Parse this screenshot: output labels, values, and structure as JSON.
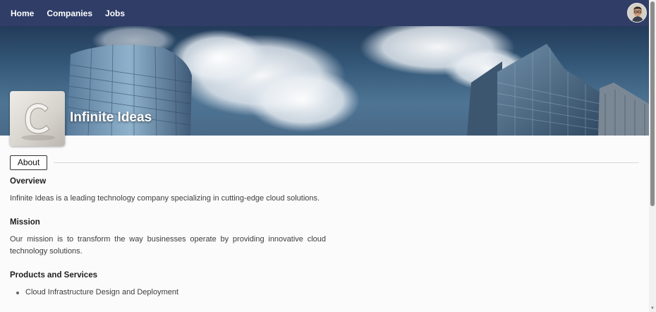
{
  "nav": {
    "links": [
      "Home",
      "Companies",
      "Jobs"
    ]
  },
  "company": {
    "name": "Infinite Ideas",
    "logo_letter": "C"
  },
  "tabs": {
    "about_label": "About"
  },
  "sections": {
    "overview": {
      "title": "Overview",
      "text": "Infinite Ideas is a leading technology company specializing in cutting-edge cloud solutions."
    },
    "mission": {
      "title": "Mission",
      "text": "Our mission is to transform the way businesses operate by providing innovative cloud technology solutions."
    },
    "products": {
      "title": "Products and Services",
      "items": [
        "Cloud Infrastructure Design and Deployment"
      ]
    }
  },
  "colors": {
    "navbar": "#2f3d67",
    "nav_text": "#ffffff"
  },
  "icons": {
    "avatar": "user-avatar-icon",
    "logo": "company-logo-icon"
  }
}
